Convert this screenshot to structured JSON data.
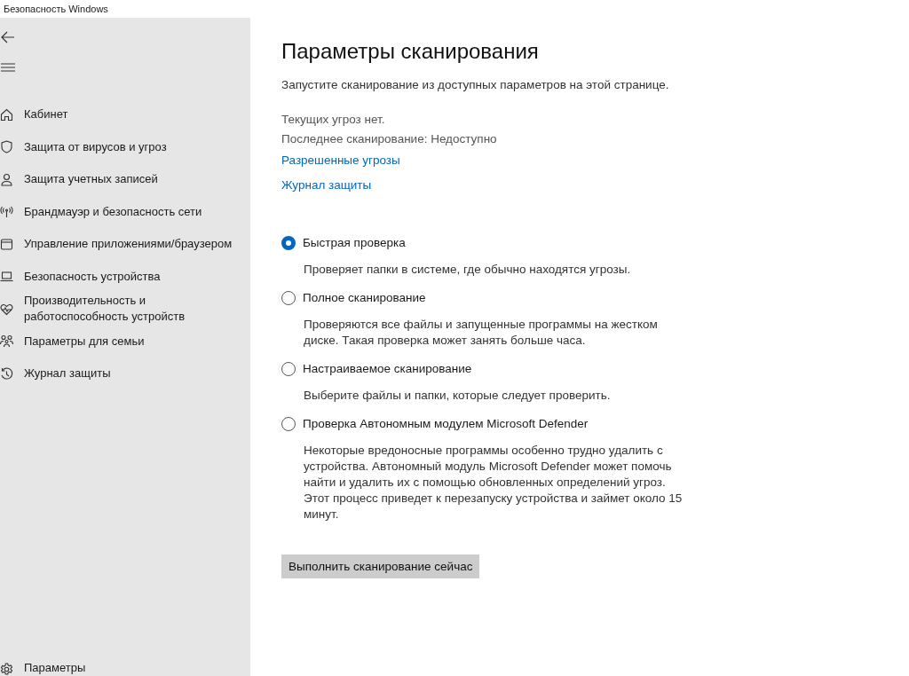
{
  "window": {
    "title": "Безопасность Windows"
  },
  "sidebar": {
    "items": [
      {
        "label": "Кабинет"
      },
      {
        "label": "Защита от вирусов и угроз"
      },
      {
        "label": "Защита учетных записей"
      },
      {
        "label": "Брандмауэр и безопасность сети"
      },
      {
        "label": "Управление приложениями/браузером"
      },
      {
        "label": "Безопасность устройства"
      },
      {
        "label": "Производительность и работоспособность устройств"
      },
      {
        "label": "Параметры для семьи"
      },
      {
        "label": "Журнал защиты"
      }
    ],
    "settings": {
      "label": "Параметры"
    }
  },
  "main": {
    "title": "Параметры сканирования",
    "subtitle": "Запустите сканирование из доступных параметров на этой странице.",
    "status": [
      "Текущих угроз нет.",
      "Последнее сканирование: Недоступно"
    ],
    "links": [
      "Разрешенные угрозы",
      "Журнал защиты"
    ],
    "options": [
      {
        "label": "Быстрая проверка",
        "description": "Проверяет папки в системе, где обычно находятся угрозы.",
        "selected": true
      },
      {
        "label": "Полное сканирование",
        "description": "Проверяются все файлы и запущенные программы на жестком диске. Такая проверка может занять больше часа.",
        "selected": false
      },
      {
        "label": "Настраиваемое сканирование",
        "description": "Выберите файлы и папки, которые следует проверить.",
        "selected": false
      },
      {
        "label": "Проверка Автономным модулем Microsoft Defender",
        "description": "Некоторые вредоносные программы особенно трудно удалить с устройства. Автономный модуль Microsoft Defender может помочь найти и удалить их с помощью обновленных определений угроз. Этот процесс приведет к перезапуску устройства и займет около 15 минут.",
        "selected": false
      }
    ],
    "button": "Выполнить сканирование сейчас"
  }
}
